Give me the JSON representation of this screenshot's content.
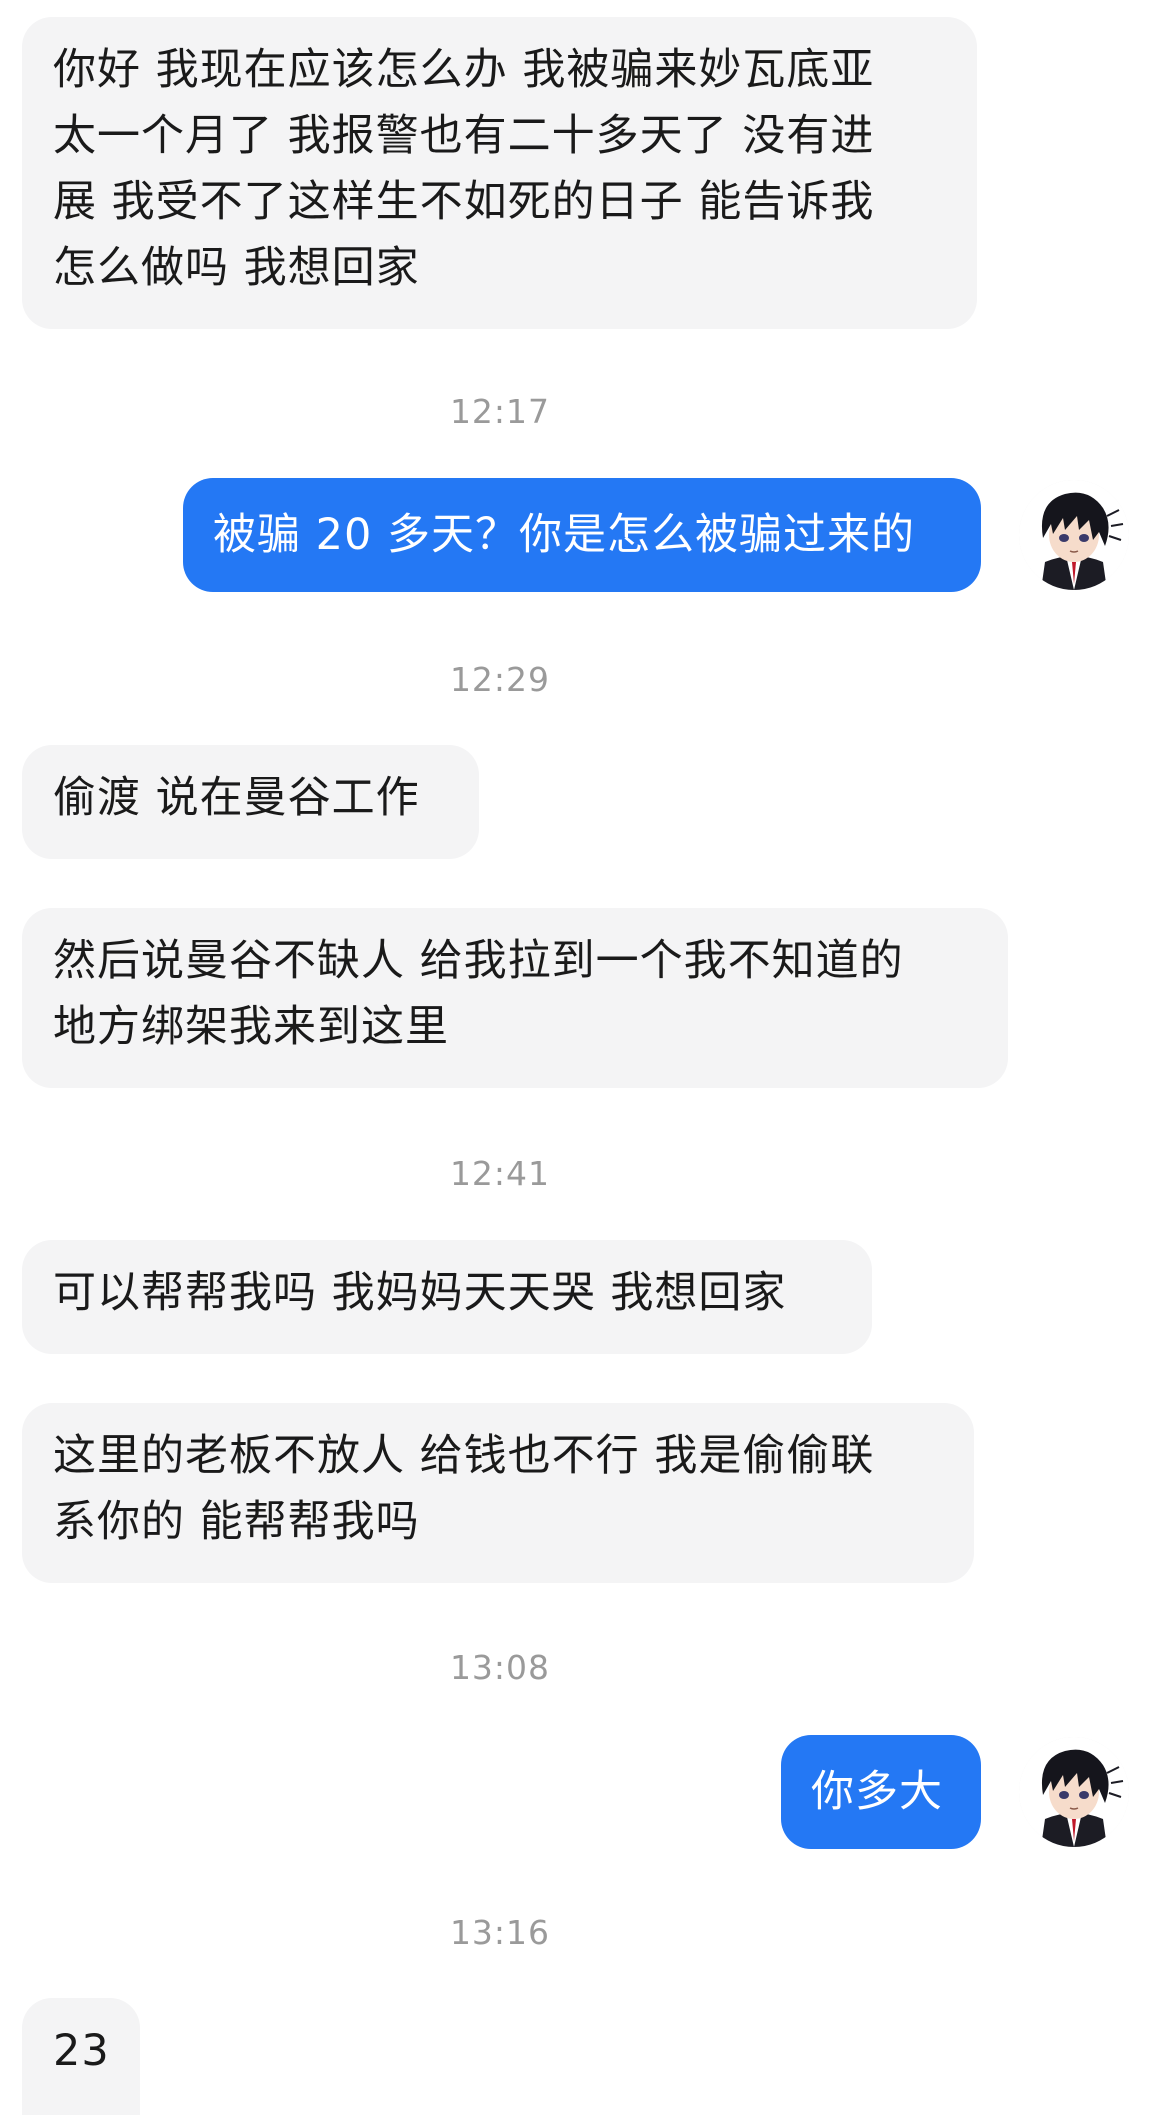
{
  "messages": [
    {
      "type": "in",
      "text": "你好 我现在应该怎么办 我被骗来妙瓦底亚\n太一个月了 我报警也有二十多天了 没有进\n展 我受不了这样生不如死的日子 能告诉我\n怎么做吗 我想回家"
    },
    {
      "type": "time",
      "text": "12:17"
    },
    {
      "type": "out",
      "text": "被骗 20 多天？你是怎么被骗过来的"
    },
    {
      "type": "time",
      "text": "12:29"
    },
    {
      "type": "in",
      "text": "偷渡 说在曼谷工作"
    },
    {
      "type": "in",
      "text": "然后说曼谷不缺人 给我拉到一个我不知道的\n地方绑架我来到这里"
    },
    {
      "type": "time",
      "text": "12:41"
    },
    {
      "type": "in",
      "text": "可以帮帮我吗 我妈妈天天哭 我想回家"
    },
    {
      "type": "in",
      "text": "这里的老板不放人 给钱也不行 我是偷偷联\n系你的 能帮帮我吗"
    },
    {
      "type": "time",
      "text": "13:08"
    },
    {
      "type": "out",
      "text": "你多大"
    },
    {
      "type": "time",
      "text": "13:16"
    },
    {
      "type": "in",
      "text": "23"
    }
  ],
  "avatar_icon": "anime-boy-avatar-icon",
  "colors": {
    "incoming_bubble": "#f4f4f5",
    "outgoing_bubble": "#2478f4",
    "timestamp": "#9a9a9a"
  }
}
